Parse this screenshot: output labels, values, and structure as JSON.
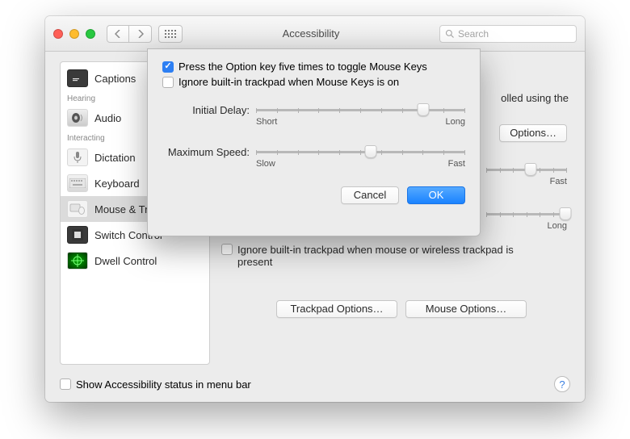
{
  "titlebar": {
    "title": "Accessibility",
    "search_placeholder": "Search"
  },
  "sidebar": {
    "sections": {
      "hearing_label": "Hearing",
      "interacting_label": "Interacting"
    },
    "captions": "Captions",
    "audio": "Audio",
    "dictation": "Dictation",
    "keyboard": "Keyboard",
    "mouse_trackpad": "Mouse & Trackpad",
    "switch_control": "Switch Control",
    "dwell_control": "Dwell Control"
  },
  "main": {
    "bg_text_fragment": "olled using the",
    "options_button": "Options…",
    "fast_label": "Fast",
    "long_label": "Long",
    "ignore_trackpad_label": "Ignore built-in trackpad when mouse or wireless trackpad is present",
    "trackpad_options_button": "Trackpad Options…",
    "mouse_options_button": "Mouse Options…"
  },
  "sheet": {
    "chk1_label": "Press the Option key five times to toggle Mouse Keys",
    "chk1_checked": true,
    "chk2_label": "Ignore built-in trackpad when Mouse Keys is on",
    "chk2_checked": false,
    "initial_delay_label": "Initial Delay:",
    "initial_delay_left": "Short",
    "initial_delay_right": "Long",
    "initial_delay_value": 0.8,
    "max_speed_label": "Maximum Speed:",
    "max_speed_left": "Slow",
    "max_speed_right": "Fast",
    "max_speed_value": 0.55,
    "cancel": "Cancel",
    "ok": "OK"
  },
  "footer": {
    "show_status_label": "Show Accessibility status in menu bar"
  }
}
